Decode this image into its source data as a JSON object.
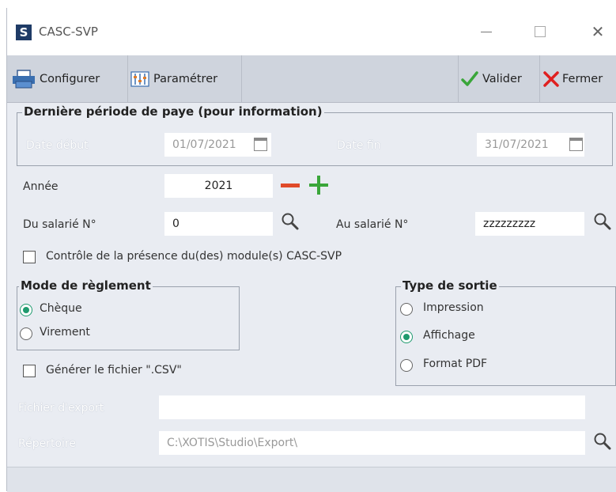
{
  "window": {
    "title": "CASC-SVP",
    "logo_letter": "S",
    "minimize_glyph": "",
    "close_glyph": "✕"
  },
  "toolbar": {
    "configurer_label": "Configurer",
    "parametrer_label": "Paramétrer",
    "valider_label": "Valider",
    "fermer_label": "Fermer",
    "valider_color": "#3aa63a",
    "fermer_color": "#e02020"
  },
  "periode": {
    "legend": "Dernière période de paye (pour information)",
    "date_debut_label": "Date début",
    "date_debut_value": "01/07/2021",
    "date_fin_label": "Date fin",
    "date_fin_value": "31/07/2021"
  },
  "annee": {
    "label": "Année",
    "value": "2021",
    "minus_color": "#e04a2a",
    "plus_color": "#3aa63a"
  },
  "salarie": {
    "du_label": "Du salarié N°",
    "du_value": "0",
    "au_label": "Au salarié N°",
    "au_value": "zzzzzzzzz"
  },
  "controle": {
    "label": "Contrôle de la présence du(des) module(s) CASC-SVP",
    "checked": false
  },
  "mode_reglement": {
    "legend": "Mode de règlement",
    "options": [
      "Chèque",
      "Virement"
    ],
    "selected": "Chèque"
  },
  "type_sortie": {
    "legend": "Type de sortie",
    "options": [
      "Impression",
      "Affichage",
      "Format PDF"
    ],
    "selected": "Affichage"
  },
  "csv": {
    "label": "Générer le fichier \".CSV\"",
    "checked": false
  },
  "export": {
    "fichier_label": "Fichier d'export",
    "fichier_value": "",
    "repertoire_label": "Répertoire",
    "repertoire_value": "C:\\XOTIS\\Studio\\Export\\"
  },
  "accent_color": "#1f9a6e"
}
